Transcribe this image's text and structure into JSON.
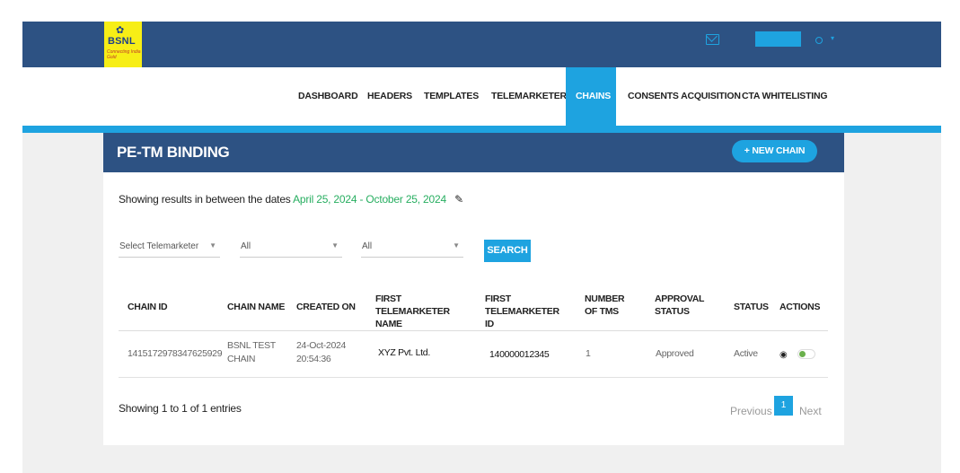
{
  "brand": {
    "logo_text": "BSNL",
    "tagline": "Connecting India Gold"
  },
  "nav": {
    "items": [
      {
        "label": "DASHBOARD"
      },
      {
        "label": "HEADERS"
      },
      {
        "label": "TEMPLATES"
      },
      {
        "label": "TELEMARKETERS"
      },
      {
        "label": "CHAINS",
        "active": true
      },
      {
        "label": "CONSENTS ACQUISITION"
      },
      {
        "label": "CTA WHITELISTING"
      }
    ]
  },
  "card": {
    "title": "PE-TM BINDING",
    "new_button": "+ NEW CHAIN"
  },
  "filters": {
    "range_prefix": "Showing results in between the dates",
    "range_dates": "April 25, 2024 - October 25, 2024",
    "telemarketer_select": "Select Telemarketer",
    "select_two": "All",
    "select_three": "All",
    "search_button": "SEARCH"
  },
  "table": {
    "headers": [
      "CHAIN ID",
      "CHAIN NAME",
      "CREATED ON",
      "FIRST TELEMARKETER NAME",
      "FIRST TELEMARKETER ID",
      "NUMBER OF TMS",
      "APPROVAL STATUS",
      "STATUS",
      "ACTIONS"
    ],
    "rows": [
      {
        "chain_id": "1415172978347625929",
        "chain_name": "BSNL TEST CHAIN",
        "created_on": "24-Oct-2024 20:54:36",
        "first_tm_name": "XYZ Pvt. Ltd.",
        "first_tm_id": "140000012345",
        "num_tms": "1",
        "approval_status": "Approved",
        "status": "Active"
      }
    ]
  },
  "pagination": {
    "entries_text": "Showing 1 to 1 of 1 entries",
    "previous": "Previous",
    "current": "1",
    "next": "Next"
  },
  "colors": {
    "navy": "#2d5283",
    "accent": "#1ea3e0",
    "logo_yellow": "#f7ee16",
    "date_green": "#27ae60"
  }
}
